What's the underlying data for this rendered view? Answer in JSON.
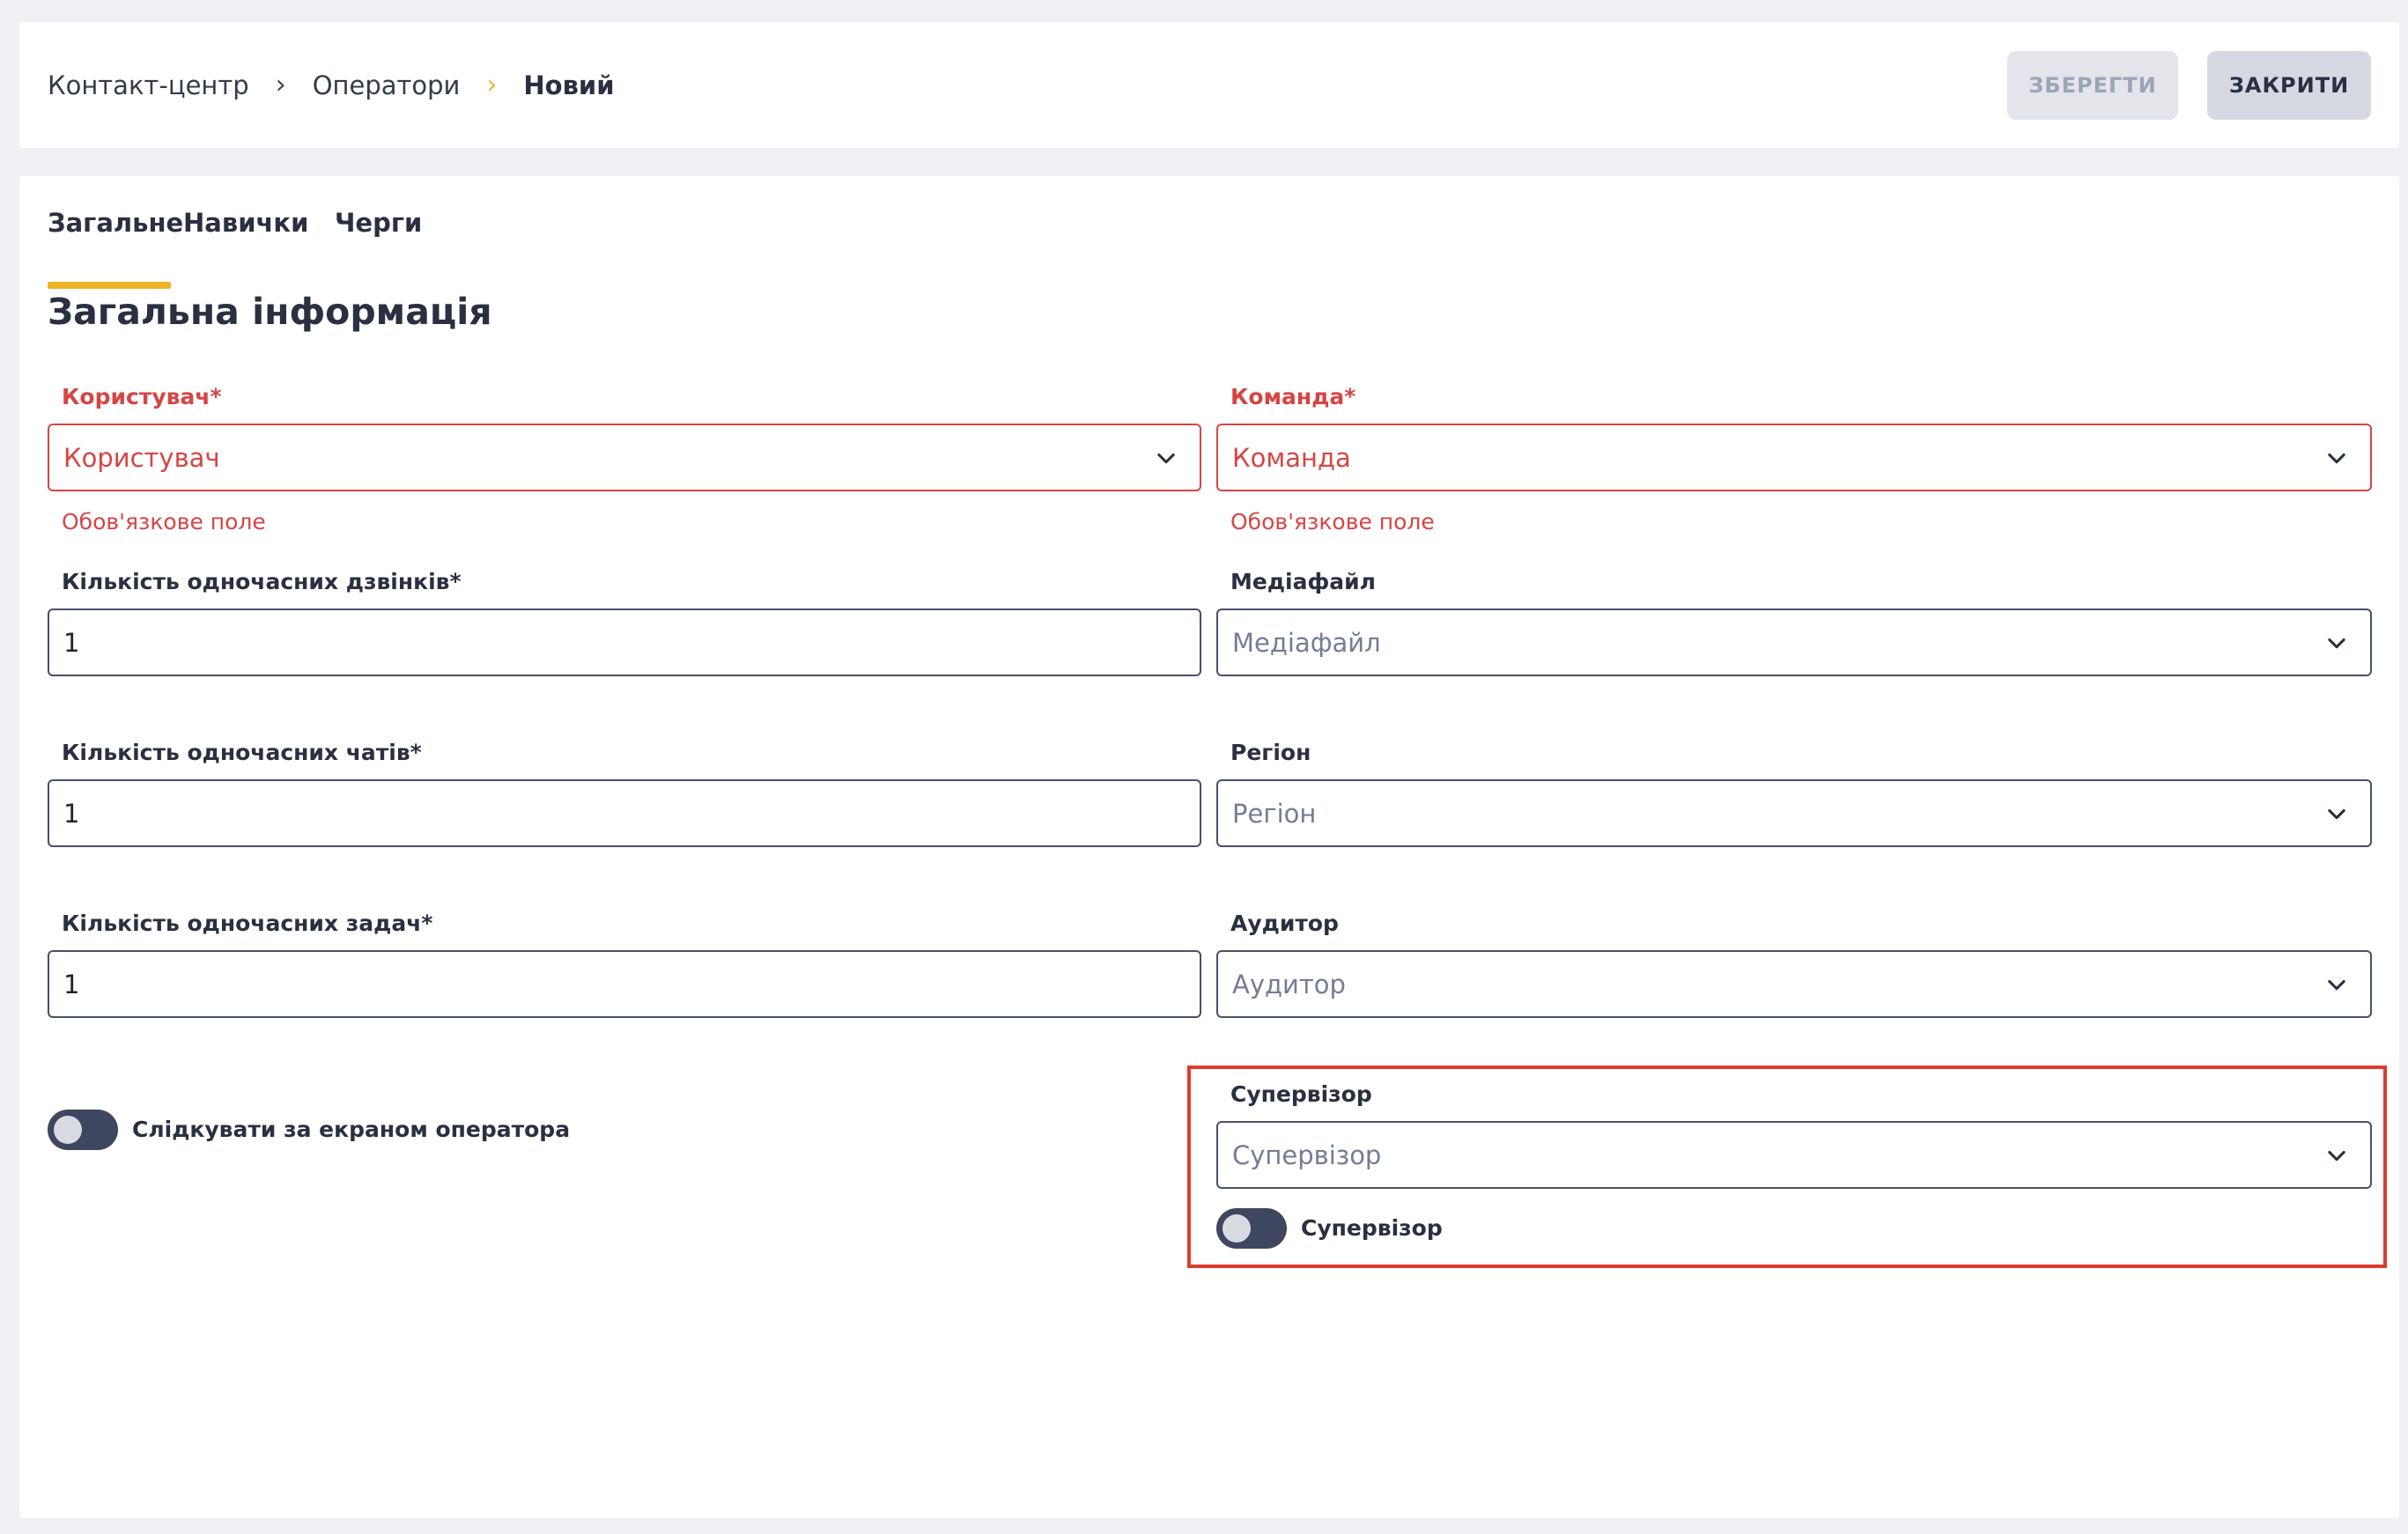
{
  "header": {
    "breadcrumb": [
      "Контакт-центр",
      "Оператори",
      "Новий"
    ],
    "save_label": "ЗБЕРЕГТИ",
    "close_label": "ЗАКРИТИ"
  },
  "tabs": [
    {
      "label": "Загальне",
      "active": true
    },
    {
      "label": "Навички",
      "active": false
    },
    {
      "label": "Черги",
      "active": false
    }
  ],
  "section_title": "Загальна інформація",
  "left": {
    "user": {
      "label": "Користувач*",
      "placeholder": "Користувач",
      "error": "Обов'язкове поле"
    },
    "calls": {
      "label": "Кількість одночасних дзвінків*",
      "value": "1"
    },
    "chats": {
      "label": "Кількість одночасних чатів*",
      "value": "1"
    },
    "tasks": {
      "label": "Кількість одночасних задач*",
      "value": "1"
    },
    "screen_toggle": {
      "label": "Слідкувати за екраном оператора",
      "on": false
    }
  },
  "right": {
    "team": {
      "label": "Команда*",
      "placeholder": "Команда",
      "error": "Обов'язкове поле"
    },
    "media": {
      "label": "Медіафайл",
      "placeholder": "Медіафайл"
    },
    "region": {
      "label": "Регіон",
      "placeholder": "Регіон"
    },
    "auditor": {
      "label": "Аудитор",
      "placeholder": "Аудитор"
    },
    "supervisor": {
      "label": "Супервізор",
      "placeholder": "Супервізор"
    },
    "supervisor_toggle": {
      "label": "Супервізор",
      "on": false
    }
  },
  "colors": {
    "accent": "#f0b429",
    "error": "#d64545",
    "highlight": "#e03a2f",
    "toggle_off": "#3f4660"
  }
}
